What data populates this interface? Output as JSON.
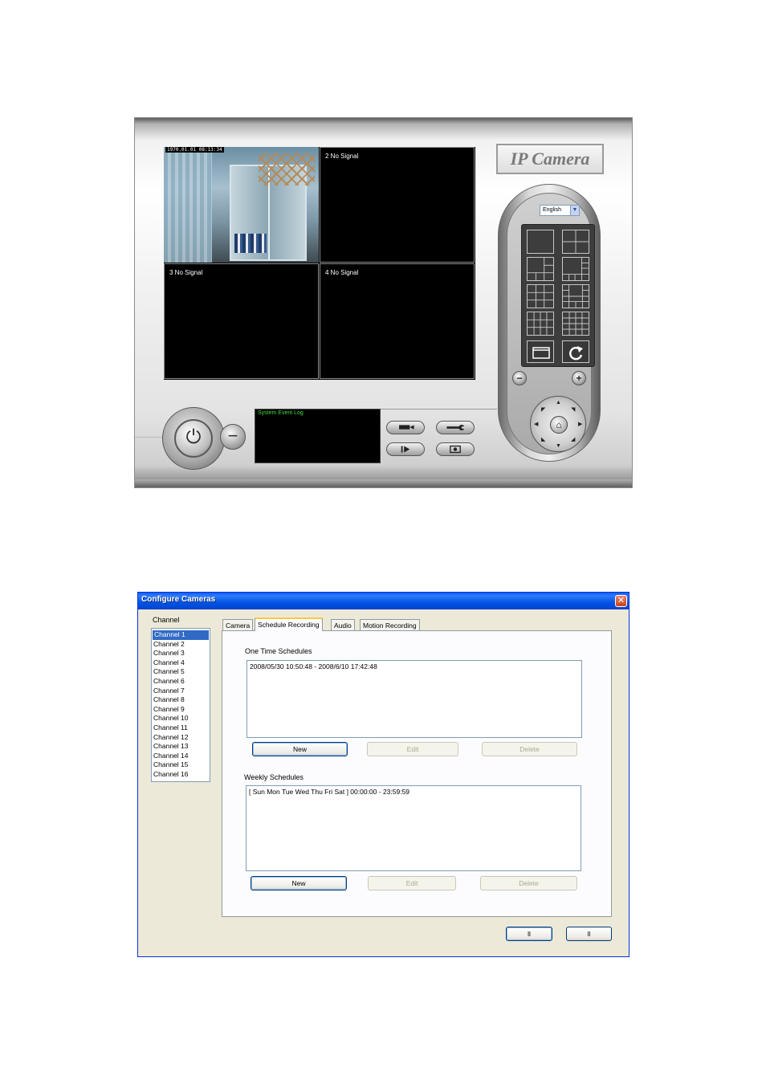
{
  "ipcam": {
    "brand": "IP Camera",
    "timestamp": "1970.01.01 08:13:34",
    "channels": [
      {
        "label": ""
      },
      {
        "label": "2 No Signal"
      },
      {
        "label": "3 No Signal"
      },
      {
        "label": "4 No Signal"
      }
    ],
    "language": "English",
    "event_log_title": "System Event Log",
    "icons": [
      "power-icon",
      "minimize-icon",
      "record-icon",
      "settings-wrench-icon",
      "playback-icon",
      "snapshot-icon",
      "fullscreen-icon",
      "rotate-icon",
      "zoom-out-icon",
      "zoom-in-icon",
      "home-icon"
    ]
  },
  "dialog": {
    "title": "Configure Cameras",
    "close": "✕",
    "channel_label": "Channel",
    "channels": [
      "Channel 1",
      "Channel 2",
      "Channel 3",
      "Channel 4",
      "Channel 5",
      "Channel 6",
      "Channel 7",
      "Channel 8",
      "Channel 9",
      "Channel 10",
      "Channel 11",
      "Channel 12",
      "Channel 13",
      "Channel 14",
      "Channel 15",
      "Channel 16"
    ],
    "selected_channel": "Channel 1",
    "tabs": [
      "Camera",
      "Schedule Recording",
      "Audio",
      "Motion Recording"
    ],
    "active_tab": "Schedule Recording",
    "one_time": {
      "title": "One Time Schedules",
      "items": [
        "2008/05/30 10:50:48 - 2008/6/10 17:42:48"
      ],
      "new": "New",
      "edit": "Edit",
      "delete": "Delete"
    },
    "weekly": {
      "title": "Weekly Schedules",
      "items": [
        "[ Sun Mon Tue Wed Thu Fri Sat ] 00:00:00 - 23:59:59"
      ],
      "new": "New",
      "edit": "Edit",
      "delete": "Delete"
    },
    "ok_label": "ll",
    "cancel_label": "ll"
  }
}
